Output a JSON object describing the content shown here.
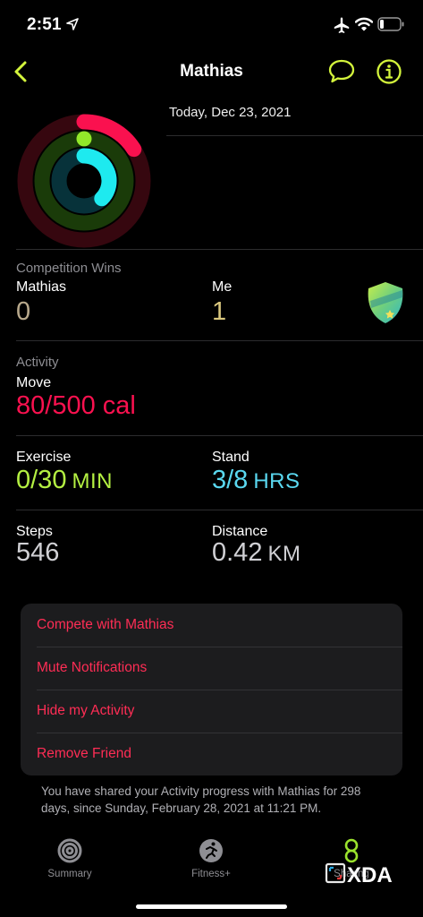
{
  "status_bar": {
    "time": "2:51"
  },
  "nav": {
    "title": "Mathias"
  },
  "date": "Today, Dec 23, 2021",
  "competition": {
    "title": "Competition Wins",
    "left_name": "Mathias",
    "left_value": "0",
    "right_name": "Me",
    "right_value": "1"
  },
  "activity": {
    "title": "Activity",
    "move_label": "Move",
    "move_value": "80/500 cal",
    "exercise_label": "Exercise",
    "exercise_value": "0/30",
    "exercise_unit": "MIN",
    "stand_label": "Stand",
    "stand_value": "3/8",
    "stand_unit": "HRS",
    "steps_label": "Steps",
    "steps_value": "546",
    "distance_label": "Distance",
    "distance_value": "0.42",
    "distance_unit": "KM"
  },
  "rings": {
    "move_fraction": 0.16,
    "exercise_fraction": 0.0,
    "stand_fraction": 0.375
  },
  "actions": [
    "Compete with Mathias",
    "Mute Notifications",
    "Hide my Activity",
    "Remove Friend"
  ],
  "footnote": "You have shared your Activity progress with Mathias for 298 days, since Sunday, February 28, 2021 at 11:21 PM.",
  "tabs": [
    {
      "label": "Summary",
      "icon": "summary-rings-icon"
    },
    {
      "label": "Fitness+",
      "icon": "fitness-plus-icon"
    },
    {
      "label": "Sharing",
      "icon": "sharing-icon"
    }
  ],
  "watermark": "XDA",
  "colors": {
    "move": "#fa114f",
    "exercise": "#92e82a",
    "stand": "#1eeaef",
    "accent": "#d4f53c",
    "destructive": "#ff2d55",
    "exercise_text": "#b4f042",
    "stand_text": "#5ad8f0"
  }
}
